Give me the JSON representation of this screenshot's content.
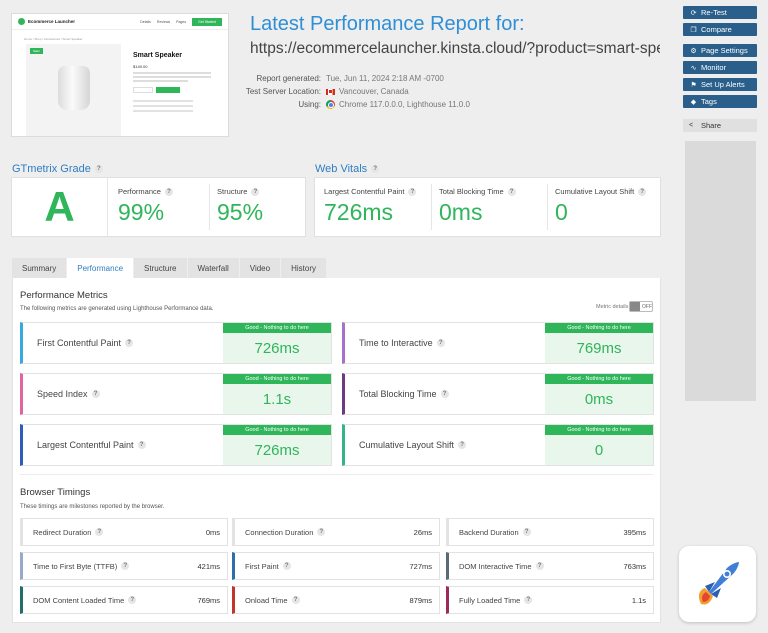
{
  "thumbnail": {
    "brand": "Ecommerce Launcher",
    "nav": [
      "Details",
      "Reviews",
      "Pages"
    ],
    "cta": "Get Started",
    "breadcrumb": "Home / Shop / Accessories / Smart Speaker",
    "sale": "Sale!",
    "product": "Smart Speaker",
    "price": "$149.00"
  },
  "report": {
    "title": "Latest Performance Report for:",
    "url": "https://ecommercelauncher.kinsta.cloud/?product=smart-spe...",
    "generated_label": "Report generated:",
    "generated_value": "Tue, Jun 11, 2024 2:18 AM -0700",
    "location_label": "Test Server Location:",
    "location_value": "Vancouver, Canada",
    "using_label": "Using:",
    "using_value": "Chrome 117.0.0.0, Lighthouse 11.0.0"
  },
  "sidebar": {
    "retest": "Re-Test",
    "compare": "Compare",
    "page_settings": "Page Settings",
    "monitor": "Monitor",
    "alerts": "Set Up Alerts",
    "tags": "Tags",
    "share": "Share"
  },
  "grade": {
    "heading": "GTmetrix Grade",
    "letter": "A",
    "performance_label": "Performance",
    "performance_value": "99%",
    "structure_label": "Structure",
    "structure_value": "95%"
  },
  "web_vitals": {
    "heading": "Web Vitals",
    "lcp_label": "Largest Contentful Paint",
    "lcp_value": "726ms",
    "tbt_label": "Total Blocking Time",
    "tbt_value": "0ms",
    "cls_label": "Cumulative Layout Shift",
    "cls_value": "0"
  },
  "tabs": [
    "Summary",
    "Performance",
    "Structure",
    "Waterfall",
    "Video",
    "History"
  ],
  "perf_metrics": {
    "title": "Performance Metrics",
    "subtitle": "The following metrics are generated using Lighthouse Performance data.",
    "details_label": "Metric details",
    "toggle_label": "OFF",
    "items": [
      {
        "name": "First Contentful Paint",
        "badge": "Good - Nothing to do here",
        "value": "726ms",
        "color": "#3aa8e0"
      },
      {
        "name": "Time to Interactive",
        "badge": "Good - Nothing to do here",
        "value": "769ms",
        "color": "#a970c9"
      },
      {
        "name": "Speed Index",
        "badge": "Good - Nothing to do here",
        "value": "1.1s",
        "color": "#e064a0"
      },
      {
        "name": "Total Blocking Time",
        "badge": "Good - Nothing to do here",
        "value": "0ms",
        "color": "#6f3a84"
      },
      {
        "name": "Largest Contentful Paint",
        "badge": "Good - Nothing to do here",
        "value": "726ms",
        "color": "#2f5eb5"
      },
      {
        "name": "Cumulative Layout Shift",
        "badge": "Good - Nothing to do here",
        "value": "0",
        "color": "#37b487"
      }
    ]
  },
  "browser_timings": {
    "title": "Browser Timings",
    "subtitle": "These timings are milestones reported by the browser.",
    "items": [
      {
        "name": "Redirect Duration",
        "value": "0ms",
        "color": "#e3e3e3"
      },
      {
        "name": "Connection Duration",
        "value": "26ms",
        "color": "#e3e3e3"
      },
      {
        "name": "Backend Duration",
        "value": "395ms",
        "color": "#e3e3e3"
      },
      {
        "name": "Time to First Byte (TTFB)",
        "value": "421ms",
        "color": "#9aa8c9"
      },
      {
        "name": "First Paint",
        "value": "727ms",
        "color": "#2f6fa8"
      },
      {
        "name": "DOM Interactive Time",
        "value": "763ms",
        "color": "#5c6b73"
      },
      {
        "name": "DOM Content Loaded Time",
        "value": "769ms",
        "color": "#1f7068"
      },
      {
        "name": "Onload Time",
        "value": "879ms",
        "color": "#c0362c"
      },
      {
        "name": "Fully Loaded Time",
        "value": "1.1s",
        "color": "#9c2a5c"
      }
    ]
  }
}
